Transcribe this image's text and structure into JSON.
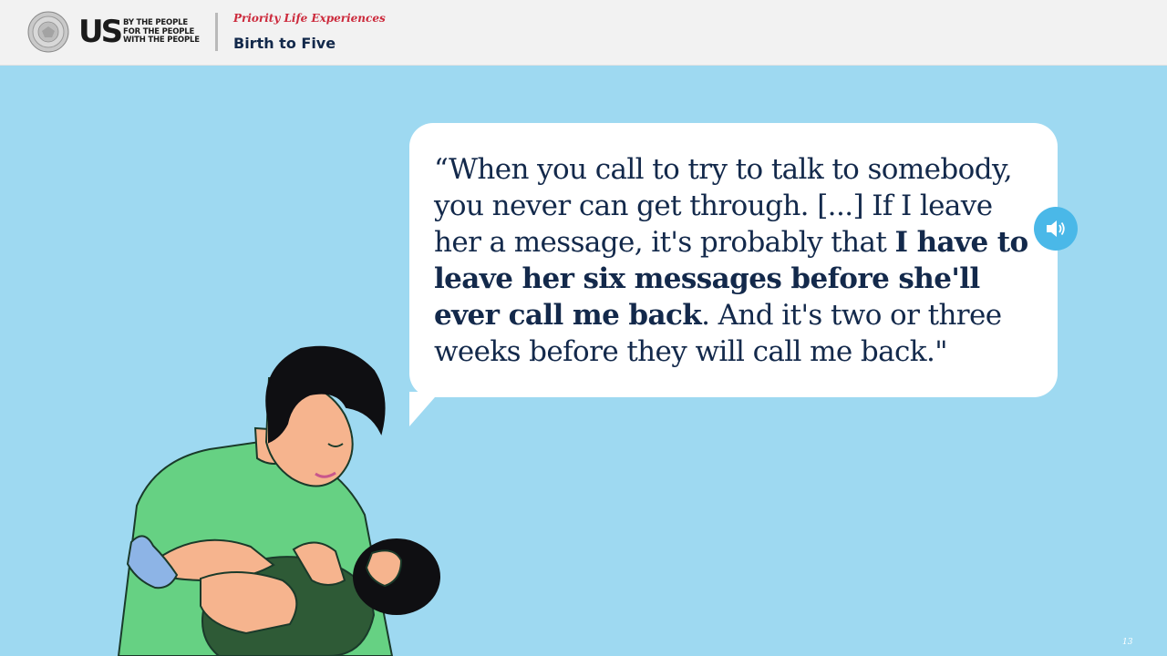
{
  "header": {
    "brand": "US",
    "tagline": [
      "BY THE PEOPLE",
      "FOR THE PEOPLE",
      "WITH THE PEOPLE"
    ],
    "subtitle": "Priority Life Experiences",
    "title": "Birth to Five"
  },
  "quote": {
    "part1": "“When you call to try to talk to somebody, you never can get through. [...] If I leave her a message, it's probably that ",
    "emphasis": "I have to leave her six messages before she'll ever call me back",
    "part2": ". And it's two or three weeks before they will call me back.\""
  },
  "audio": {
    "icon": "speaker-icon"
  },
  "page_number": "13",
  "colors": {
    "background": "#9ed9f1",
    "header": "#f2f2f2",
    "navy": "#13294b",
    "red": "#cc2a3c",
    "audio": "#4ab8e8"
  }
}
